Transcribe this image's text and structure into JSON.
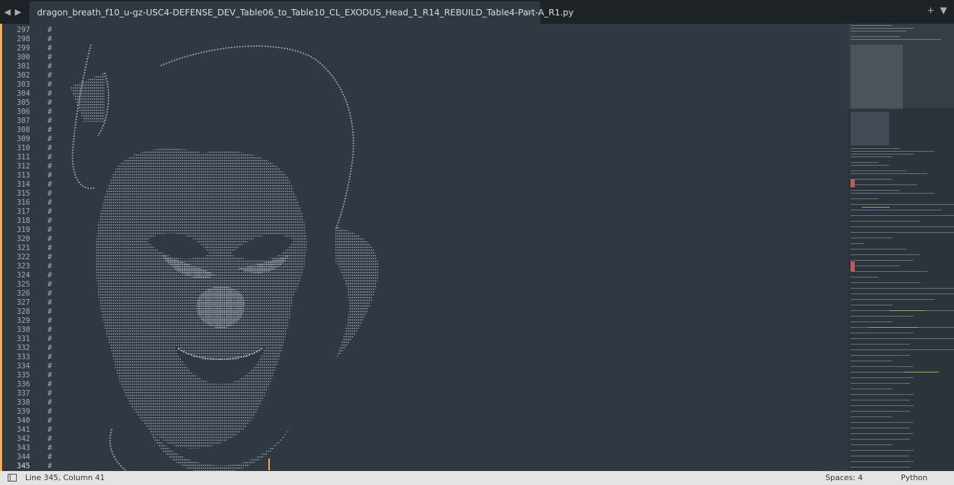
{
  "tab": {
    "title": "dragon_breath_f10_u-gz-USC4-DEFENSE_DEV_Table06_to_Table10_CL_EXODUS_Head_1_R14_REBUILD_Table4-Part-A_R1.py",
    "close": "×"
  },
  "nav": {
    "back": "◀",
    "forward": "▶"
  },
  "tools": {
    "new_tab": "+",
    "menu": "▼"
  },
  "editor": {
    "line_numbers": [
      "297",
      "298",
      "299",
      "300",
      "301",
      "302",
      "303",
      "304",
      "305",
      "306",
      "307",
      "308",
      "309",
      "310",
      "311",
      "312",
      "313",
      "314",
      "315",
      "316",
      "317",
      "318",
      "319",
      "320",
      "321",
      "322",
      "323",
      "324",
      "325",
      "326",
      "327",
      "328",
      "329",
      "330",
      "331",
      "332",
      "333",
      "334",
      "335",
      "336",
      "337",
      "338",
      "339",
      "340",
      "341",
      "342",
      "343",
      "344",
      "345"
    ],
    "comment_char": "#",
    "current_line": "345"
  },
  "status": {
    "position": "Line 345, Column 41",
    "spaces": "Spaces: 4",
    "syntax": "Python"
  },
  "colors": {
    "background": "#303841",
    "accent": "#f9ae58",
    "text": "#a6acb4",
    "statusbar": "#e4e4e4"
  }
}
